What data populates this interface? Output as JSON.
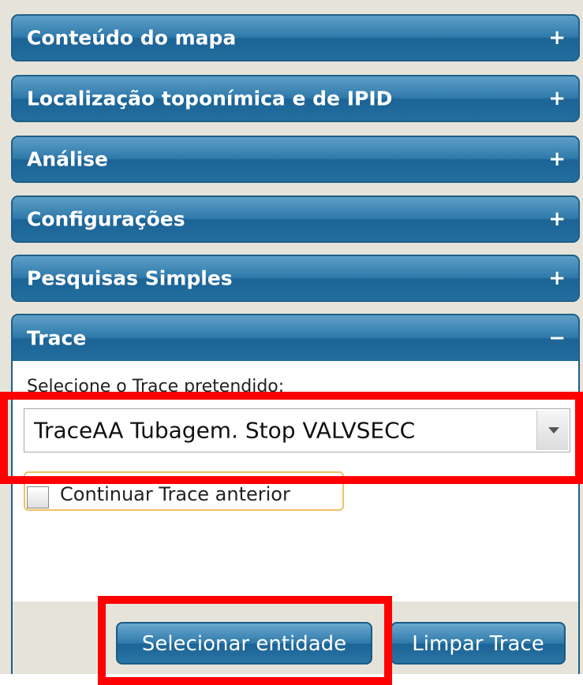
{
  "accordion": {
    "sections": [
      {
        "title": "Conteúdo do mapa",
        "toggle": "+"
      },
      {
        "title": "Localização toponímica e de IPID",
        "toggle": "+"
      },
      {
        "title": "Análise",
        "toggle": "+"
      },
      {
        "title": "Configurações",
        "toggle": "+"
      },
      {
        "title": "Pesquisas Simples",
        "toggle": "+"
      },
      {
        "title": "Trace",
        "toggle": "−"
      }
    ]
  },
  "trace": {
    "select_label": "Selecione o Trace pretendido:",
    "selected_value": "TraceAA Tubagem. Stop VALVSECC",
    "continue_label": "Continuar Trace anterior",
    "continue_checked": false,
    "select_entity_button": "Selecionar entidade",
    "clear_trace_button": "Limpar Trace"
  },
  "colors": {
    "header_blue": "#2f7aab",
    "highlight_red": "#ff0000",
    "panel_background": "#e6e4da"
  }
}
